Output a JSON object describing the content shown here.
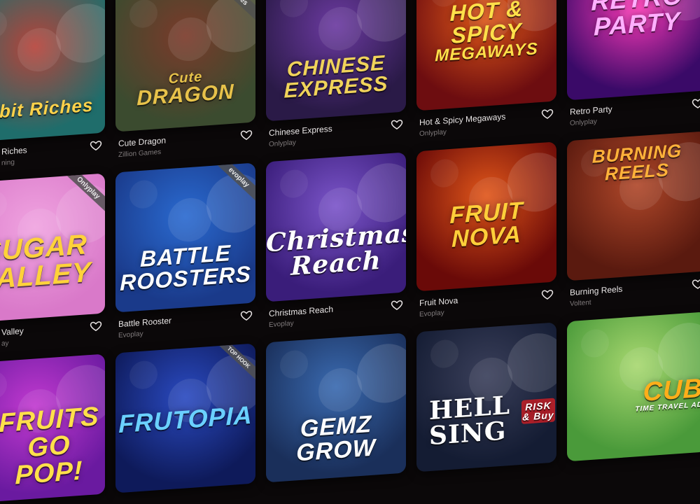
{
  "games": [
    {
      "name": "Riches",
      "provider": "ning",
      "title": "abbit Riches",
      "subtitle": "",
      "badge": "",
      "colors": [
        "#1f6d6b",
        "#b5433a"
      ],
      "title_color": "#ffd24a"
    },
    {
      "name": "Cute Dragon",
      "provider": "Zillion Games",
      "title": "DRAGON",
      "subtitle": "Cute",
      "badge": "games",
      "colors": [
        "#3b4b2f",
        "#7a3a2a"
      ],
      "title_color": "#e7c24a"
    },
    {
      "name": "Chinese Express",
      "provider": "Onlyplay",
      "title": "CHINESE EXPRESS",
      "subtitle": "",
      "badge": "",
      "colors": [
        "#2a1a47",
        "#6b3aa0"
      ],
      "title_color": "#f0d35a"
    },
    {
      "name": "Hot & Spicy Megaways",
      "provider": "Onlyplay",
      "title": "HOT & SPICY",
      "subtitle": "MEGAWAYS",
      "badge": "",
      "colors": [
        "#6d0d10",
        "#e25a1a"
      ],
      "title_color": "#ffe04a"
    },
    {
      "name": "Retro Party",
      "provider": "Onlyplay",
      "title": "RETRO PARTY",
      "subtitle": "",
      "badge": "",
      "colors": [
        "#3a0a68",
        "#ff3ab8"
      ],
      "title_color": "#ffb0ff"
    },
    {
      "name": "Valley",
      "provider": "ay",
      "title": "SUGAR VALLEY",
      "subtitle": "",
      "badge": "Onlyplay",
      "colors": [
        "#d979c9",
        "#f0a3e0"
      ],
      "title_color": "#ffd23a"
    },
    {
      "name": "Battle Rooster",
      "provider": "Evoplay",
      "title": "BATTLE ROOSTERS",
      "subtitle": "",
      "badge": "evoplay",
      "colors": [
        "#1a3a8a",
        "#2a6ad0"
      ],
      "title_color": "#ffffff"
    },
    {
      "name": "Christmas Reach",
      "provider": "Evoplay",
      "title": "Christmas Reach",
      "subtitle": "",
      "badge": "",
      "colors": [
        "#3a1d7a",
        "#7b55c9"
      ],
      "title_color": "#ffffff"
    },
    {
      "name": "Fruit Nova",
      "provider": "Evoplay",
      "title": "FRUIT NOVA",
      "subtitle": "",
      "badge": "",
      "colors": [
        "#6a0a08",
        "#e0561a"
      ],
      "title_color": "#ffcf3a"
    },
    {
      "name": "Burning Reels",
      "provider": "Voltent",
      "title": "BURNING REELS",
      "subtitle": "",
      "badge": "",
      "colors": [
        "#5a1a0f",
        "#b0482a"
      ],
      "title_color": "#ffb23a"
    },
    {
      "name": "",
      "provider": "",
      "title": "FRUITS GO POP!",
      "subtitle": "",
      "badge": "",
      "colors": [
        "#6a1aa0",
        "#c23ad0"
      ],
      "title_color": "#ffe04a"
    },
    {
      "name": "",
      "provider": "",
      "title": "FRUTOPIA",
      "subtitle": "",
      "badge": "TOP HOOK",
      "colors": [
        "#0e1a5a",
        "#2a4ac0"
      ],
      "title_color": "#6ad0ff"
    },
    {
      "name": "",
      "provider": "",
      "title": "GEMZ GROW",
      "subtitle": "",
      "badge": "",
      "colors": [
        "#1a2f5a",
        "#3a6ab0"
      ],
      "title_color": "#ffffff"
    },
    {
      "name": "",
      "provider": "",
      "title": "HELL SING",
      "subtitle": "RISK & Buy",
      "badge": "",
      "colors": [
        "#141c33",
        "#3a3f5a"
      ],
      "title_color": "#ffffff"
    },
    {
      "name": "",
      "provider": "",
      "title": "CUB",
      "subtitle": "TIME TRAVEL AD",
      "badge": "",
      "colors": [
        "#4a9a3a",
        "#a8d870"
      ],
      "title_color": "#ffae1a"
    }
  ],
  "icons": {
    "favorite": "heart-icon"
  }
}
